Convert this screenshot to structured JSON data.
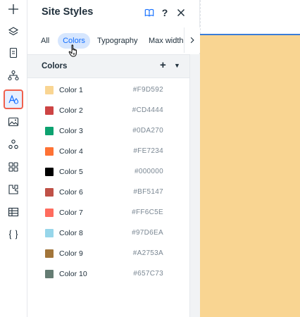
{
  "panel": {
    "title": "Site Styles"
  },
  "header": {
    "help_label": "?",
    "close_label": "✕"
  },
  "tabs": [
    {
      "label": "All"
    },
    {
      "label": "Colors"
    },
    {
      "label": "Typography"
    },
    {
      "label": "Max width"
    }
  ],
  "section": {
    "title": "Colors",
    "add_label": "+",
    "caret": "▼"
  },
  "tab_arrow": "›",
  "colors": [
    {
      "name": "Color 1",
      "hex": "#F9D592"
    },
    {
      "name": "Color 2",
      "hex": "#CD4444"
    },
    {
      "name": "Color 3",
      "hex": "#0DA270"
    },
    {
      "name": "Color 4",
      "hex": "#FE7234"
    },
    {
      "name": "Color 5",
      "hex": "#000000"
    },
    {
      "name": "Color 6",
      "hex": "#BF5147"
    },
    {
      "name": "Color 7",
      "hex": "#FF6C5E"
    },
    {
      "name": "Color 8",
      "hex": "#97D6EA"
    },
    {
      "name": "Color 9",
      "hex": "#A2753A"
    },
    {
      "name": "Color 10",
      "hex": "#657C73"
    }
  ],
  "canvas": {
    "fill_color": "#F9D592"
  },
  "toolbar_icons": [
    "add-icon",
    "layers-icon",
    "pages-icon",
    "sitemap-icon",
    "site-styles-icon",
    "media-icon",
    "apps-icon",
    "app-market-icon",
    "business-icon",
    "table-icon",
    "code-icon"
  ]
}
